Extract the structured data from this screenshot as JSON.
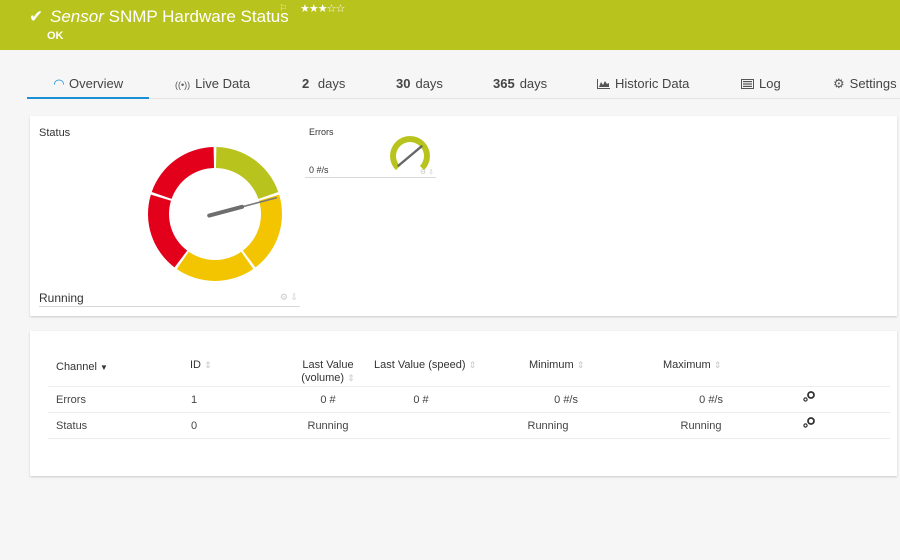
{
  "header": {
    "status_icon": "checkmark-icon",
    "sensor_type": "Sensor",
    "title": "SNMP Hardware Status",
    "flag_icon": "flag-icon",
    "priority": "★★★☆☆",
    "priority_value": "3 of 5",
    "state": "OK",
    "color": "#b8c31d"
  },
  "tabs": [
    {
      "label": "Overview",
      "icon": "gauge-icon",
      "glyph": "◠",
      "active": true
    },
    {
      "label": "Live Data",
      "icon": "broadcast-icon",
      "glyph": "((•))"
    },
    {
      "num": "2",
      "label": "days"
    },
    {
      "num": "30",
      "label": "days"
    },
    {
      "num": "365",
      "label": "days"
    },
    {
      "label": "Historic Data",
      "icon": "area-chart-icon",
      "glyph": "▟"
    },
    {
      "label": "Log",
      "icon": "log-icon",
      "glyph": "▤"
    },
    {
      "label": "Settings",
      "icon": "gear-icon",
      "glyph": "⚙"
    }
  ],
  "gauges": {
    "status": {
      "label": "Status",
      "value_text": "Running",
      "needle_fraction": 0.12,
      "segments": [
        {
          "color": "#b8c31d",
          "from": 0.0,
          "to": 0.2
        },
        {
          "color": "#f2c500",
          "from": 0.2,
          "to": 0.4
        },
        {
          "color": "#f2c500",
          "from": 0.4,
          "to": 0.6
        },
        {
          "color": "#e2001a",
          "from": 0.6,
          "to": 0.8
        },
        {
          "color": "#e2001a",
          "from": 0.8,
          "to": 1.0
        }
      ]
    },
    "errors": {
      "label": "Errors",
      "value_text": "0 #/s",
      "color": "#b8c31d",
      "needle_fraction": 0.0
    },
    "mini_icons": "⚙ ⇩"
  },
  "table": {
    "headers": [
      {
        "label": "Channel",
        "sort": "▼"
      },
      {
        "label": "ID",
        "sort": "⇕"
      },
      {
        "label": "Last Value",
        "label2": "(volume)",
        "sort": "⇕"
      },
      {
        "label": "Last Value (speed)",
        "sort": "⇕"
      },
      {
        "label": "Minimum",
        "sort": "⇕"
      },
      {
        "label": "Maximum",
        "sort": "⇕"
      }
    ],
    "rows": [
      {
        "channel": "Errors",
        "id": "1",
        "volume": "0 #",
        "speed": "0 #",
        "min": "0 #/s",
        "max": "0 #/s"
      },
      {
        "channel": "Status",
        "id": "0",
        "volume": "Running",
        "speed": "",
        "min": "Running",
        "max": "Running"
      }
    ]
  }
}
